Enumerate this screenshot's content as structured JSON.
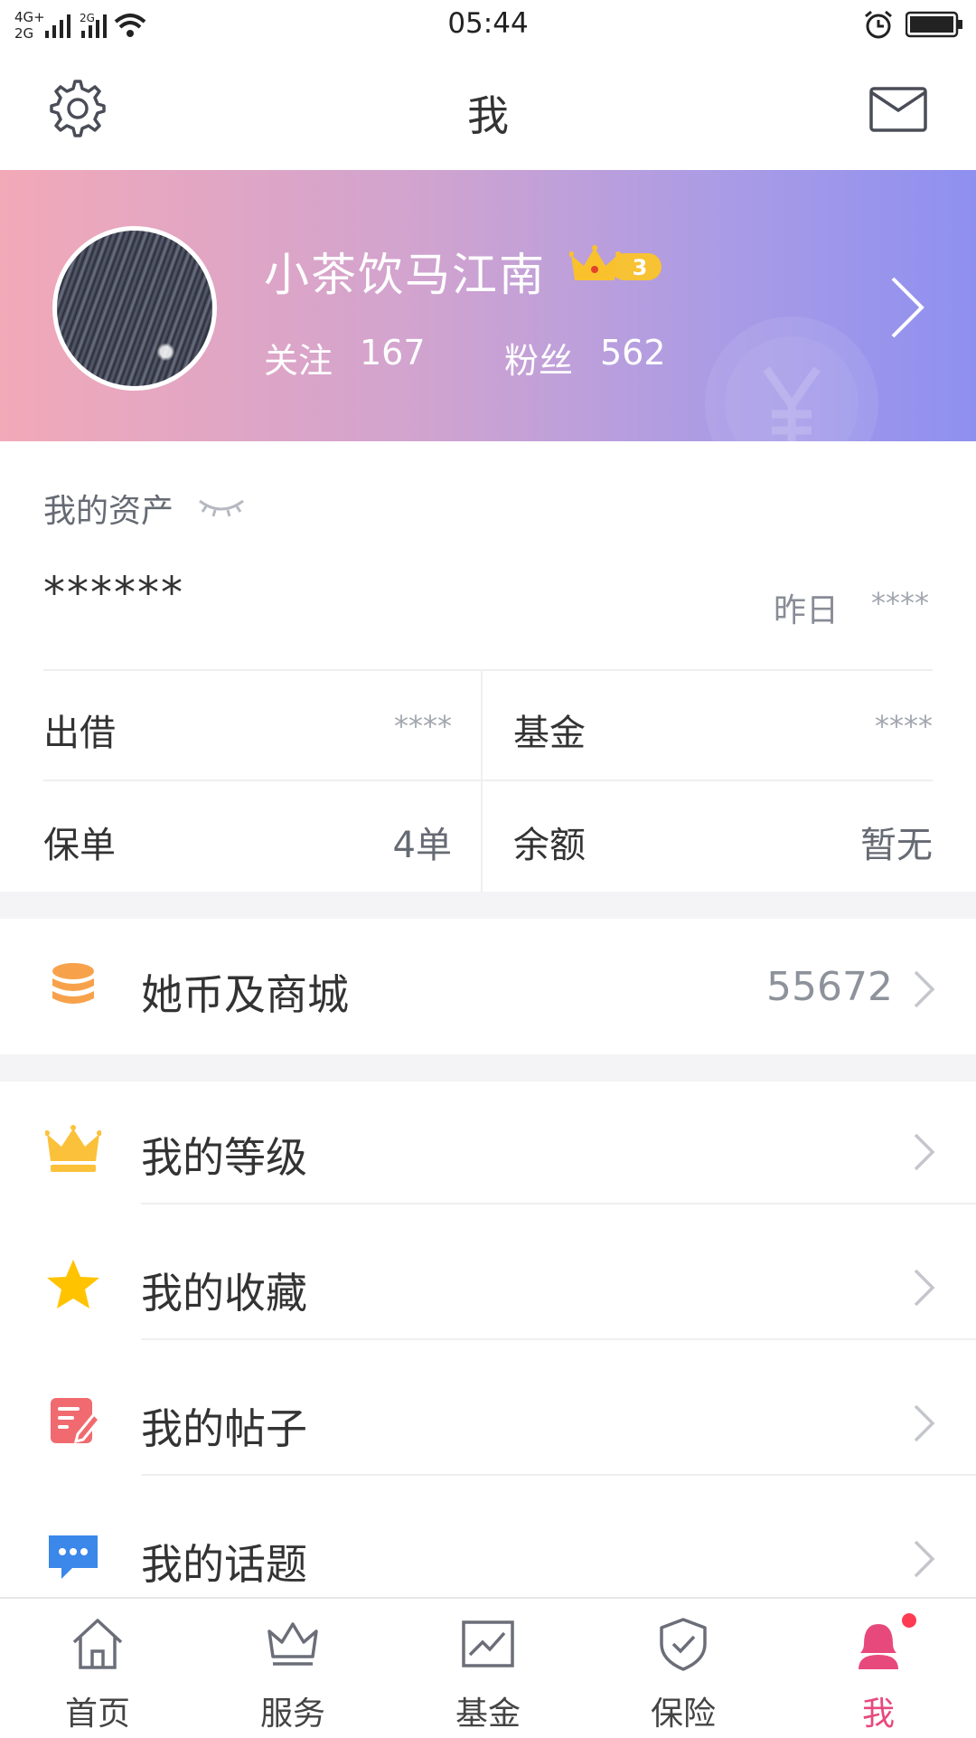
{
  "status_bar": {
    "network": "4G+ 2G",
    "time": "05:44"
  },
  "header": {
    "title": "我",
    "settings_icon": "gear-icon",
    "mail_icon": "envelope-icon"
  },
  "profile": {
    "nickname": "小茶饮马江南",
    "level": "3",
    "follow_label": "关注",
    "follow_count": "167",
    "fans_label": "粉丝",
    "fans_count": "562",
    "watermark_symbol": "¥"
  },
  "assets": {
    "title": "我的资产",
    "total": "******",
    "yesterday_label": "昨日",
    "yesterday_value": "****",
    "cells": [
      {
        "label": "出借",
        "value": "****"
      },
      {
        "label": "基金",
        "value": "****"
      },
      {
        "label": "保单",
        "value": "4单"
      },
      {
        "label": "余额",
        "value": "暂无"
      }
    ]
  },
  "coins": {
    "label": "她币及商城",
    "value": "55672",
    "icon": "coin-stack-icon"
  },
  "menu": [
    {
      "label": "我的等级",
      "icon": "crown-icon"
    },
    {
      "label": "我的收藏",
      "icon": "star-icon"
    },
    {
      "label": "我的帖子",
      "icon": "post-edit-icon"
    },
    {
      "label": "我的话题",
      "icon": "chat-bubble-icon"
    }
  ],
  "bottom_nav": [
    {
      "label": "首页",
      "icon": "home-icon",
      "active": false
    },
    {
      "label": "服务",
      "icon": "crown-outline-icon",
      "active": false
    },
    {
      "label": "基金",
      "icon": "chart-icon",
      "active": false
    },
    {
      "label": "保险",
      "icon": "shield-check-icon",
      "active": false
    },
    {
      "label": "我",
      "icon": "user-icon",
      "active": true
    }
  ],
  "colors": {
    "accent": "#e8497d",
    "banner_start": "#f2a9b8",
    "banner_end": "#8e90f0",
    "coin": "#f7a24b",
    "star": "#ffc300",
    "post": "#f06a6f",
    "chat": "#3b87ea"
  }
}
